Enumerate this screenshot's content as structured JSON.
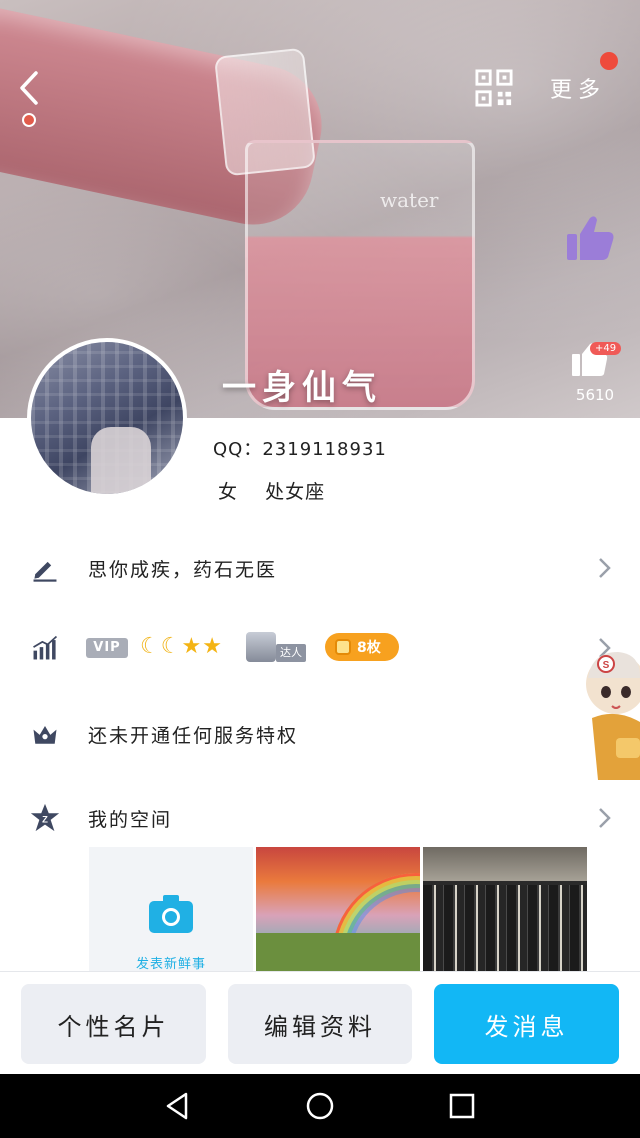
{
  "header": {
    "more_label": "更多",
    "nickname": "一身仙气",
    "cover_word": "water",
    "like_count_badge": "+49",
    "like_count": "5610"
  },
  "profile": {
    "qq_line": "QQ：2319118931",
    "gender": "女",
    "zodiac": "处女座"
  },
  "rows": {
    "signature": "思你成疾，药石无医",
    "vip_label": "VIP",
    "daren_label": "达人",
    "coins_label": "8枚",
    "privilege": "还未开通任何服务特权",
    "space": "我的空间"
  },
  "gallery": {
    "post_label": "发表新鲜事"
  },
  "bottom": {
    "card_label": "个性名片",
    "edit_label": "编辑资料",
    "message_label": "发消息"
  },
  "colors": {
    "accent": "#12B7F5",
    "coin": "#F7A11F",
    "red_dot": "#EE4B3C",
    "like_purple": "#9B7DD8"
  },
  "icons": [
    "back-icon",
    "qr-code-icon",
    "thumb-up-icon",
    "heart-stack-icon",
    "pencil-icon",
    "level-chart-icon",
    "crown-icon",
    "qzone-star-icon",
    "chevron-right-icon",
    "camera-icon",
    "nav-back-icon",
    "nav-home-icon",
    "nav-recent-icon"
  ]
}
